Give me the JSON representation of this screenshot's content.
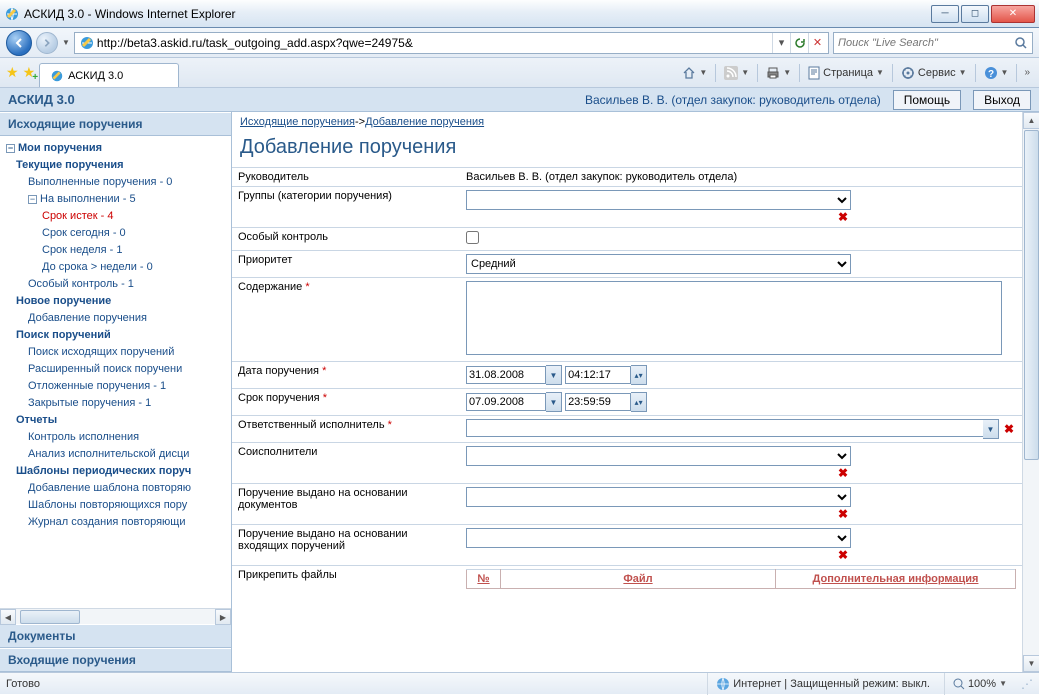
{
  "window": {
    "title": "АСКИД 3.0 - Windows Internet Explorer"
  },
  "address": {
    "url": "http://beta3.askid.ru/task_outgoing_add.aspx?qwe=24975&"
  },
  "search": {
    "placeholder": "Поиск \"Live Search\""
  },
  "tab": {
    "title": "АСКИД 3.0"
  },
  "toolbar": {
    "page": "Страница",
    "tools": "Сервис"
  },
  "app": {
    "name": "АСКИД 3.0",
    "user": "Васильев В. В. (отдел закупок: руководитель отдела)",
    "help": "Помощь",
    "exit": "Выход"
  },
  "sidebar": {
    "s1": "Исходящие поручения",
    "items": {
      "my": "Мои поручения",
      "current": "Текущие поручения",
      "done": "Выполненные поручения - 0",
      "inprog": "На выполнении - 5",
      "expired": "Срок истек - 4",
      "today": "Срок сегодня - 0",
      "week": "Срок неделя - 1",
      "more": "До срока > недели - 0",
      "special": "Особый контроль - 1",
      "new": "Новое поручение",
      "add": "Добавление поручения",
      "search": "Поиск поручений",
      "searchout": "Поиск исходящих поручений",
      "ext": "Расширенный поиск поручени",
      "deferred": "Отложенные поручения - 1",
      "closed": "Закрытые поручения - 1",
      "reports": "Отчеты",
      "ctrl": "Контроль исполнения",
      "analysis": "Анализ исполнительской дисци",
      "templates": "Шаблоны периодических поруч",
      "addtpl": "Добавление шаблона повторяю",
      "tpls": "Шаблоны повторяющихся пору",
      "log": "Журнал создания повторяющи"
    },
    "s2": "Документы",
    "s3": "Входящие поручения"
  },
  "crumbs": {
    "a": "Исходящие поручения",
    "b": "Добавление поручения"
  },
  "page": {
    "title": "Добавление поручения"
  },
  "form": {
    "managerLbl": "Руководитель",
    "managerVal": "Васильев В. В. (отдел закупок: руководитель отдела)",
    "groupsLbl": "Группы (категории поручения)",
    "specialLbl": "Особый контроль",
    "priorityLbl": "Приоритет",
    "priorityVal": "Средний",
    "contentLbl": "Содержание",
    "dateLbl": "Дата поручения",
    "dateVal": "31.08.2008",
    "dateTime": "04:12:17",
    "dueLbl": "Срок поручения",
    "dueVal": "07.09.2008",
    "dueTime": "23:59:59",
    "respLbl": "Ответственный исполнитель",
    "coLbl": "Соисполнители",
    "basisDocLbl": "Поручение выдано на основании документов",
    "basisInLbl": "Поручение выдано на основании входящих поручений",
    "filesLbl": "Прикрепить файлы",
    "col1": "№",
    "col2": "Файл",
    "col3": "Дополнительная информация"
  },
  "status": {
    "ready": "Готово",
    "zone": "Интернет | Защищенный режим: выкл.",
    "zoom": "100%"
  }
}
